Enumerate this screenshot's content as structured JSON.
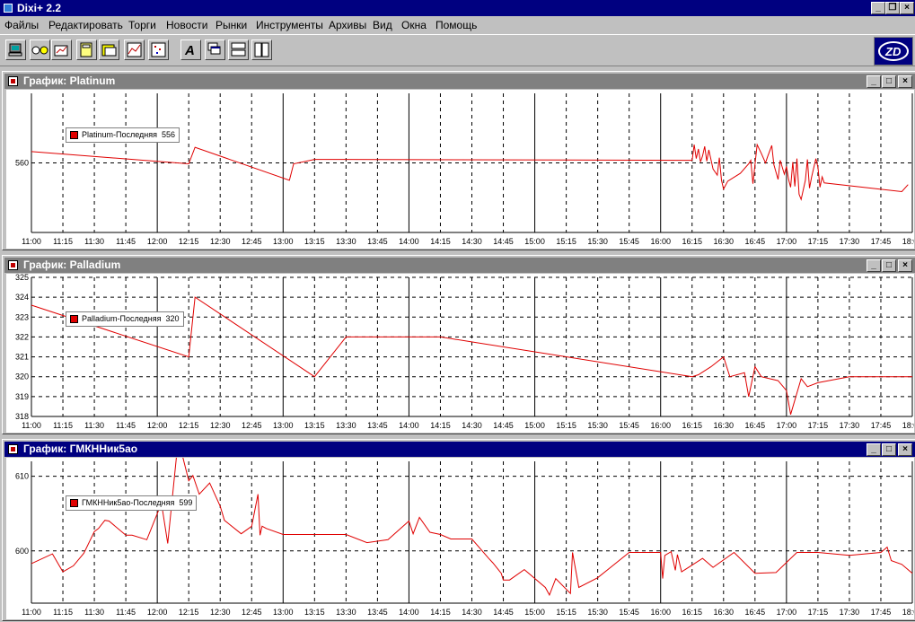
{
  "app": {
    "title": "Dixi+ 2.2"
  },
  "menu": [
    "Файлы",
    "Редактировать",
    "Торги",
    "Новости",
    "Рынки",
    "Инструменты",
    "Архивы",
    "Вид",
    "Окна",
    "Помощь"
  ],
  "toolbar_icons": [
    "terminal-icon",
    "glasses-icon",
    "portfolio-icon",
    "calculator-icon",
    "orders-icon",
    "chart-icon",
    "scatter-icon",
    "text-tool-icon",
    "cascade-icon",
    "tile-horizontal-icon",
    "tile-vertical-icon"
  ],
  "colors": {
    "line": "#e00000",
    "titlebar": "#000080",
    "grid": "#000000"
  },
  "x_ticks": [
    "11:00",
    "11:15",
    "11:30",
    "11:45",
    "12:00",
    "12:15",
    "12:30",
    "12:45",
    "13:00",
    "13:15",
    "13:30",
    "13:45",
    "14:00",
    "14:15",
    "14:30",
    "14:45",
    "15:00",
    "15:15",
    "15:30",
    "15:45",
    "16:00",
    "16:15",
    "16:30",
    "16:45",
    "17:00",
    "17:15",
    "17:30",
    "17:45",
    "18:00"
  ],
  "chart_data": [
    {
      "type": "line",
      "title": "График: Platinum",
      "legend": {
        "series": "Platinum-Последняя",
        "value": "556"
      },
      "y_ticks": [
        560
      ],
      "ylim": [
        552,
        568
      ],
      "x": [
        "11:00",
        "12:15",
        "12:18",
        "13:03",
        "13:05",
        "13:15",
        "16:15",
        "16:16",
        "16:17",
        "16:18",
        "16:19",
        "16:20",
        "16:21",
        "16:22",
        "16:23",
        "16:25",
        "16:27",
        "16:28",
        "16:29",
        "16:30",
        "16:32",
        "16:38",
        "16:42",
        "16:43",
        "16:44",
        "16:46",
        "16:48",
        "16:50",
        "16:51",
        "16:53",
        "16:54",
        "16:56",
        "16:57",
        "16:59",
        "17:00",
        "17:01",
        "17:02",
        "17:03",
        "17:04",
        "17:05",
        "17:06",
        "17:07",
        "17:09",
        "17:10",
        "17:11",
        "17:12",
        "17:14",
        "17:15",
        "17:16",
        "17:17",
        "17:18",
        "17:55",
        "17:58"
      ],
      "series": [
        {
          "values": [
            561.3,
            559.9,
            561.8,
            558.0,
            559.9,
            560.4,
            560.3,
            562.1,
            560.5,
            561.6,
            560.1,
            560.8,
            561.9,
            560.2,
            561.5,
            559.3,
            558.6,
            560.6,
            558.0,
            557.0,
            557.9,
            558.8,
            559.9,
            560.3,
            557.6,
            562.1,
            561.1,
            560.0,
            560.7,
            562.0,
            559.8,
            558.1,
            560.3,
            558.7,
            559.6,
            558.1,
            557.2,
            560.1,
            557.3,
            560.5,
            556.4,
            555.8,
            558.0,
            560.4,
            557.1,
            558.4,
            560.5,
            559.5,
            557.2,
            558.4,
            557.7,
            556.7,
            557.5
          ]
        }
      ]
    },
    {
      "type": "line",
      "title": "График: Palladium",
      "legend": {
        "series": "Palladium-Последняя",
        "value": "320"
      },
      "y_ticks": [
        318,
        319,
        320,
        321,
        322,
        323,
        324,
        325
      ],
      "ylim": [
        318,
        325
      ],
      "x": [
        "11:00",
        "12:15",
        "12:18",
        "13:15",
        "13:30",
        "14:15",
        "16:15",
        "16:18",
        "16:24",
        "16:30",
        "16:33",
        "16:40",
        "16:42",
        "16:45",
        "16:48",
        "16:56",
        "17:00",
        "17:02",
        "17:07",
        "17:10",
        "17:15",
        "17:30",
        "18:00"
      ],
      "series": [
        {
          "values": [
            323.6,
            321.0,
            324.0,
            320.0,
            322.0,
            322.0,
            320.0,
            320.1,
            320.5,
            321.0,
            320.0,
            320.2,
            319.0,
            320.5,
            320.0,
            319.8,
            319.3,
            318.1,
            319.9,
            319.5,
            319.7,
            320.0,
            320.0
          ]
        }
      ]
    },
    {
      "type": "line",
      "title": "График: ГМКННик5ао",
      "legend": {
        "series": "ГМКННик5ао-Последняя",
        "value": "599"
      },
      "y_ticks": [
        600,
        610
      ],
      "ylim": [
        593,
        612
      ],
      "x": [
        "11:00",
        "11:10",
        "11:15",
        "11:20",
        "11:25",
        "11:30",
        "11:32",
        "11:35",
        "11:37",
        "11:45",
        "11:48",
        "11:55",
        "12:02",
        "12:05",
        "12:10",
        "12:15",
        "12:17",
        "12:20",
        "12:25",
        "12:30",
        "12:32",
        "12:40",
        "12:45",
        "12:48",
        "12:49",
        "12:50",
        "12:52",
        "13:00",
        "13:10",
        "13:20",
        "13:30",
        "13:40",
        "13:50",
        "14:00",
        "14:02",
        "14:05",
        "14:10",
        "14:15",
        "14:20",
        "14:30",
        "14:38",
        "14:40",
        "14:44",
        "14:45",
        "14:48",
        "14:55",
        "15:05",
        "15:07",
        "15:10",
        "15:17",
        "15:18",
        "15:21",
        "15:30",
        "15:45",
        "15:50",
        "16:00",
        "16:01",
        "16:02",
        "16:05",
        "16:07",
        "16:08",
        "16:10",
        "16:20",
        "16:25",
        "16:35",
        "16:45",
        "16:55",
        "17:05",
        "17:15",
        "17:30",
        "17:45",
        "17:48",
        "17:50",
        "17:55",
        "18:00"
      ],
      "series": [
        {
          "values": [
            598.3,
            599.6,
            597.2,
            598.0,
            599.7,
            602.6,
            603.0,
            604.1,
            604.0,
            602.1,
            602.1,
            601.5,
            606.4,
            601.0,
            615.0,
            609.4,
            610.1,
            607.6,
            609.1,
            606.0,
            604.1,
            602.3,
            603.3,
            607.6,
            602.1,
            603.3,
            603.0,
            602.2,
            602.2,
            602.2,
            602.2,
            601.1,
            601.5,
            604.0,
            602.3,
            604.5,
            602.5,
            602.2,
            601.6,
            601.6,
            599.0,
            598.4,
            597.0,
            596.1,
            596.1,
            597.5,
            595.1,
            594.1,
            596.3,
            594.3,
            599.8,
            595.1,
            596.4,
            599.8,
            599.8,
            599.8,
            596.3,
            599.4,
            599.9,
            597.4,
            599.5,
            597.2,
            599.0,
            597.8,
            599.8,
            597.0,
            597.1,
            599.8,
            599.8,
            599.4,
            599.8,
            600.5,
            598.7,
            598.2,
            597.0
          ]
        }
      ]
    }
  ]
}
